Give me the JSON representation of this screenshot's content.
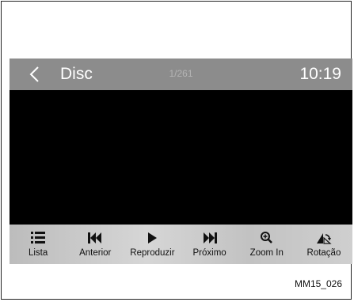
{
  "header": {
    "back_icon": "chevron-left-icon",
    "title": "Disc",
    "counter": "1/261",
    "time": "10:19"
  },
  "toolbar": {
    "items": [
      {
        "label": "Lista",
        "icon": "list-icon"
      },
      {
        "label": "Anterior",
        "icon": "skip-previous-icon"
      },
      {
        "label": "Reproduzir",
        "icon": "play-icon"
      },
      {
        "label": "Próximo",
        "icon": "skip-next-icon"
      },
      {
        "label": "Zoom In",
        "icon": "zoom-in-icon"
      },
      {
        "label": "Rotação",
        "icon": "rotate-icon"
      }
    ]
  },
  "caption": "MM15_026",
  "colors": {
    "header_bg": "#8c8c8c",
    "screen_bg": "#000000",
    "toolbar_bg": "#c8c8c8"
  }
}
